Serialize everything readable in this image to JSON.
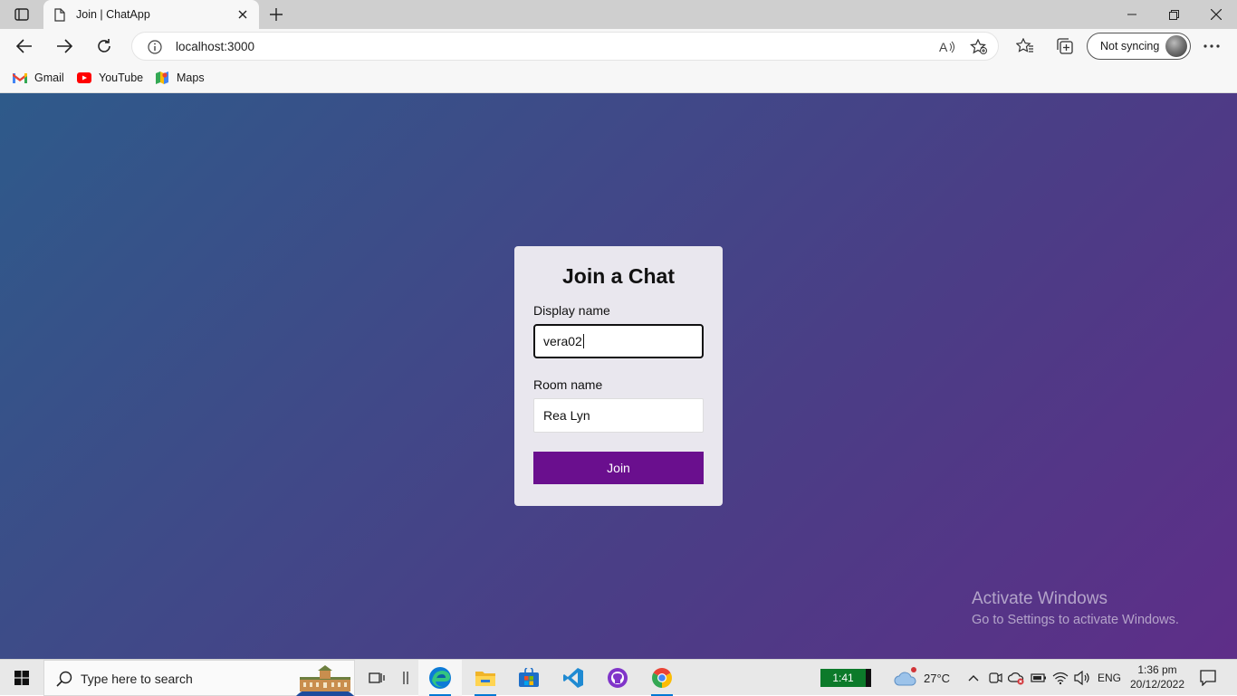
{
  "browser": {
    "tab_title": "Join | ChatApp",
    "url": "localhost:3000",
    "profile_label": "Not syncing",
    "bookmarks": [
      {
        "label": "Gmail",
        "icon": "gmail-icon"
      },
      {
        "label": "YouTube",
        "icon": "youtube-icon"
      },
      {
        "label": "Maps",
        "icon": "maps-icon"
      }
    ]
  },
  "join_form": {
    "heading": "Join a Chat",
    "display_name_label": "Display name",
    "display_name_value": "vera02",
    "room_name_label": "Room name",
    "room_name_value": "Rea Lyn",
    "join_label": "Join"
  },
  "watermark": {
    "line1": "Activate Windows",
    "line2": "Go to Settings to activate Windows."
  },
  "taskbar": {
    "search_placeholder": "Type here to search",
    "timer": "1:41",
    "temperature": "27°C",
    "language": "ENG",
    "time": "1:36 pm",
    "date": "20/12/2022",
    "apps": [
      "task-view-icon",
      "widgets-icon",
      "edge-icon",
      "file-explorer-icon",
      "store-icon",
      "vscode-icon",
      "github-desktop-icon",
      "chrome-icon"
    ]
  },
  "colors": {
    "join_button": "#6a0f8e",
    "background_start": "#2e5a8a",
    "background_end": "#5e2e88"
  }
}
